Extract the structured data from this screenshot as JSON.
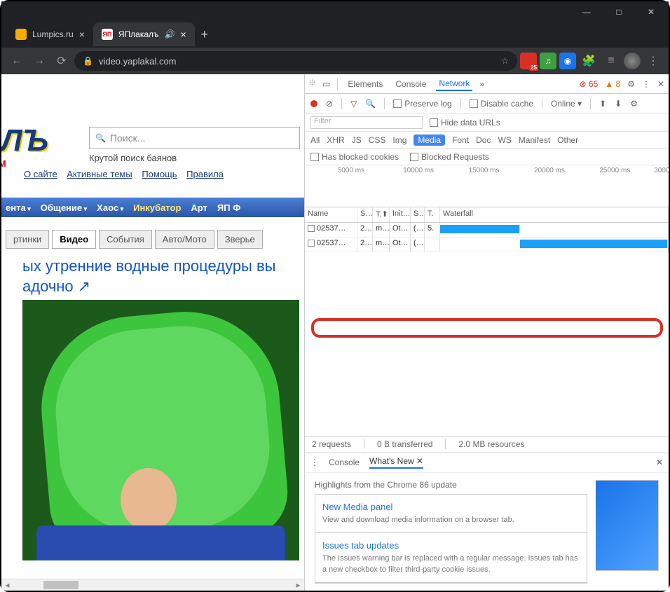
{
  "window": {
    "min": "—",
    "max": "□",
    "close": "✕"
  },
  "tabs": [
    {
      "title": "Lumpics.ru",
      "active": false
    },
    {
      "title": "ЯПлакалъ",
      "active": true,
      "audio": "🔊"
    }
  ],
  "newtab": "+",
  "nav": {
    "back": "←",
    "fwd": "→",
    "reload": "⟳"
  },
  "omnibox": {
    "lock": "🔒",
    "url": "video.yaplakal.com",
    "star": "☆"
  },
  "ext": {
    "badge": "25",
    "puzzle": "🧩",
    "readlist": "≡",
    "menu": "⋮"
  },
  "page": {
    "logo1": "КАЛЪ",
    "logo2": "KAL.COM",
    "search_placeholder": "Поиск...",
    "tagline": "Крутой поиск баянов",
    "links": [
      "О сайте",
      "Активные темы",
      "Помощь",
      "Правила"
    ],
    "menu": [
      "ента",
      "Общение",
      "Хаос",
      "Инкубатор",
      "Арт",
      "ЯП Ф"
    ],
    "subtabs": [
      "ртинки",
      "Видео",
      "События",
      "Авто/Мото",
      "Зверье"
    ],
    "subtab_active": 1,
    "headline": "ых утренние водные процедуры вы\nадочно ↗"
  },
  "devtools": {
    "inspect": "⯐",
    "device": "▭",
    "tabs": [
      "Elements",
      "Console",
      "Network"
    ],
    "active_tab": 2,
    "more": "»",
    "err_icon": "⊗",
    "errors": "65",
    "warn_icon": "▲",
    "warnings": "8",
    "gear": "⚙",
    "vmenu": "⋮",
    "close": "✕",
    "netbar": {
      "clear": "⊘",
      "filter": "▽",
      "search": "🔍",
      "preserve": "Preserve log",
      "disable": "Disable cache",
      "online": "Online",
      "down": "▾",
      "up": "⬆",
      "dl": "⬇"
    },
    "filter_placeholder": "Filter",
    "hide_urls": "Hide data URLs",
    "types": [
      "All",
      "XHR",
      "JS",
      "CSS",
      "Img",
      "Media",
      "Font",
      "Doc",
      "WS",
      "Manifest",
      "Other"
    ],
    "type_sel": 5,
    "cookies": {
      "blocked": "Has blocked cookies",
      "requests": "Blocked Requests"
    },
    "ticks": [
      {
        "l": "5000 ms",
        "p": 9
      },
      {
        "l": "10000 ms",
        "p": 27
      },
      {
        "l": "15000 ms",
        "p": 45
      },
      {
        "l": "20000 ms",
        "p": 63
      },
      {
        "l": "25000 ms",
        "p": 81
      },
      {
        "l": "3000",
        "p": 96
      }
    ],
    "cols": [
      "Name",
      "S…",
      "T.⬆",
      "Init…",
      "S…",
      "T.",
      "Waterfall"
    ],
    "rows": [
      {
        "name": "02537…",
        "s": "2…",
        "t": "m…",
        "i": "Ot…",
        "sz": "(…",
        "tm": "5.",
        "wf_l": 0,
        "wf_w": 35
      },
      {
        "name": "02537…",
        "s": "2…",
        "t": "m…",
        "i": "Ot…",
        "sz": "(…",
        "tm": "",
        "wf_l": 35,
        "wf_w": 65
      }
    ],
    "status": {
      "req": "2 requests",
      "xfer": "0 B transferred",
      "res": "2.0 MB resources"
    },
    "drawer": {
      "menu": "⋮",
      "tabs": [
        "Console",
        "What's New"
      ],
      "active": 1,
      "tabx": "✕",
      "close": "✕",
      "heading": "Highlights from the Chrome 86 update",
      "cards": [
        {
          "t": "New Media panel",
          "b": "View and download media information on a browser tab."
        },
        {
          "t": "Issues tab updates",
          "b": "The Issues warning bar is replaced with a regular message. Issues tab has a new checkbox to filter third-party cookie issues."
        }
      ]
    }
  }
}
